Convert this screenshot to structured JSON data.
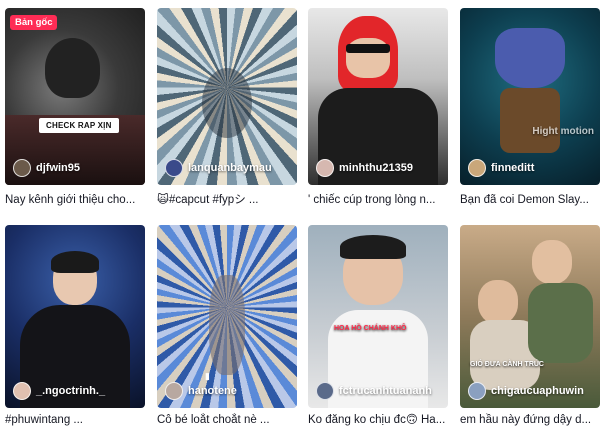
{
  "videos": [
    {
      "badge": "Bản gốc",
      "overlay_button": "CHECK RAP XỊN",
      "username": "djfwin95",
      "caption": "Nay kênh giới thiệu cho...",
      "colors": [
        "#2b2b2b",
        "#6a6a6a"
      ]
    },
    {
      "username": "lanquanbaymau",
      "caption": "🙀#capcut #fypシ ...",
      "colors": [
        "#8fb5c8",
        "#2b3645"
      ]
    },
    {
      "username": "minhthu21359",
      "caption": "' chiếc cúp trong lòng n...",
      "colors": [
        "#d8d8d8",
        "#2c2c2c"
      ]
    },
    {
      "username": "finneditt",
      "watermark": "Hight motion",
      "caption": "Bạn đã coi Demon Slay...",
      "colors": [
        "#0e4a5b",
        "#1a2a3a"
      ]
    },
    {
      "username": "_.ngoctrinh._",
      "caption": "#phuwintang ...",
      "colors": [
        "#1d3c7a",
        "#0a1228"
      ]
    },
    {
      "username": "hanotene",
      "caption": "Cô bé loắt choắt nè ...",
      "colors": [
        "#3b6ac0",
        "#a7b6d8"
      ]
    },
    {
      "username": "fctrucanhtuananh",
      "sticker": "HOA HỒ CHÁNH KHÔ",
      "caption": "Ko đăng ko chịu đc🙃 Ha...",
      "colors": [
        "#8a9aa8",
        "#c8cdd2"
      ]
    },
    {
      "username": "chigaucuaphuwin",
      "sticker": "GIÓ ĐƯA CÀNH TRÚC",
      "caption": "em hầu này đứng dậy d...",
      "colors": [
        "#b89572",
        "#5a7a4a"
      ]
    }
  ]
}
